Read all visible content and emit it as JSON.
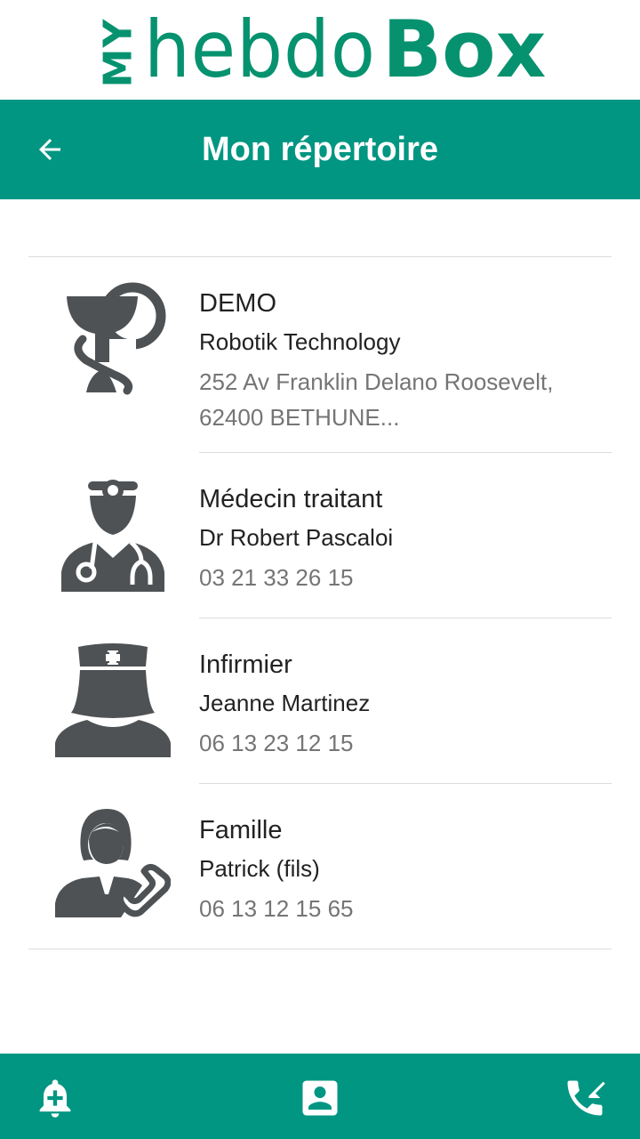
{
  "logo": {
    "my": "MY",
    "hebdo": "hebdo",
    "box": "Box"
  },
  "header": {
    "title": "Mon répertoire",
    "back_icon": "arrow-left-icon"
  },
  "contacts": [
    {
      "type": "DEMO",
      "name": "Robotik Technology",
      "detail_lines": [
        "252 Av Franklin Delano Roosevelt,",
        "62400 BETHUNE..."
      ],
      "icon": "pharmacy-icon"
    },
    {
      "type": "Médecin traitant",
      "name": "Dr Robert Pascaloi",
      "detail_lines": [
        "03 21 33 26 15"
      ],
      "icon": "doctor-icon"
    },
    {
      "type": "Infirmier",
      "name": "Jeanne Martinez",
      "detail_lines": [
        "06 13 23 12 15"
      ],
      "icon": "nurse-icon"
    },
    {
      "type": "Famille",
      "name": "Patrick (fils)",
      "detail_lines": [
        "06 13 12 15 65"
      ],
      "icon": "family-contact-icon"
    }
  ],
  "bottom_nav": [
    {
      "icon": "alarm-add-icon"
    },
    {
      "icon": "contact-card-icon"
    },
    {
      "icon": "missed-call-icon"
    }
  ],
  "colors": {
    "primary": "#009682",
    "logo_green": "#07926f",
    "icon_gray": "#4f5254",
    "text_dark": "#222222",
    "text_muted": "#757575"
  }
}
